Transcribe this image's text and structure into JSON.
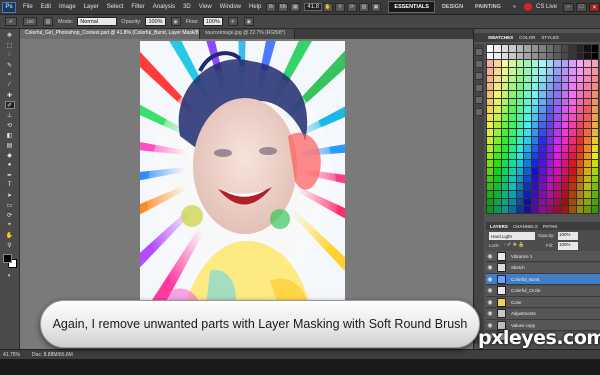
{
  "menubar": {
    "app_badge": "Ps",
    "items": [
      "File",
      "Edit",
      "Image",
      "Layer",
      "Select",
      "Filter",
      "Analysis",
      "3D",
      "View",
      "Window",
      "Help"
    ],
    "zoom_value": "41.8",
    "workspace": {
      "active": "ESSENTIALS",
      "others": [
        "DESIGN",
        "PAINTING"
      ]
    },
    "more_label": "»",
    "cslive_label": "CS Live",
    "window_controls": [
      "–",
      "□",
      "✕"
    ]
  },
  "options_bar": {
    "mode_label": "Mode:",
    "mode_value": "Normal",
    "opacity_label": "Opacity:",
    "opacity_value": "100%",
    "flow_label": "Flow:",
    "flow_value": "100%",
    "brush_size": "100"
  },
  "tabs": [
    {
      "label": "Colorful_Girl_Photoshop_Contest.psd @ 41.8% (Colorful_Burst, Layer Mask/8)",
      "active": true
    },
    {
      "label": "sourceimage.jpg @ 22.7% (RGB/8*)",
      "active": false
    }
  ],
  "toolbar": {
    "tools": [
      {
        "name": "move-tool",
        "icon": "✥"
      },
      {
        "name": "marquee-tool",
        "icon": "⬚"
      },
      {
        "name": "lasso-tool",
        "icon": "◌"
      },
      {
        "name": "quick-select-tool",
        "icon": "✎"
      },
      {
        "name": "crop-tool",
        "icon": "⌗"
      },
      {
        "name": "eyedropper-tool",
        "icon": "⁄"
      },
      {
        "name": "heal-tool",
        "icon": "✚"
      },
      {
        "name": "brush-tool",
        "icon": "✐",
        "selected": true
      },
      {
        "name": "stamp-tool",
        "icon": "⊥"
      },
      {
        "name": "history-brush-tool",
        "icon": "⟲"
      },
      {
        "name": "eraser-tool",
        "icon": "◧"
      },
      {
        "name": "gradient-tool",
        "icon": "▤"
      },
      {
        "name": "blur-tool",
        "icon": "◆"
      },
      {
        "name": "dodge-tool",
        "icon": "●"
      },
      {
        "name": "pen-tool",
        "icon": "✒"
      },
      {
        "name": "type-tool",
        "icon": "T"
      },
      {
        "name": "path-select-tool",
        "icon": "➤"
      },
      {
        "name": "shape-tool",
        "icon": "▭"
      },
      {
        "name": "3d-rotate-tool",
        "icon": "⟳"
      },
      {
        "name": "3d-camera-tool",
        "icon": "⌖"
      },
      {
        "name": "hand-tool",
        "icon": "✋"
      },
      {
        "name": "zoom-tool",
        "icon": "⚲"
      }
    ],
    "fg_color": "#000000",
    "bg_color": "#ffffff"
  },
  "status": {
    "zoom": "41.75%",
    "doc": "Doc: 8.88M/86.8M"
  },
  "swatches_panel": {
    "tabs": [
      {
        "label": "SWATCHES",
        "active": true
      },
      {
        "label": "COLOR",
        "active": false
      },
      {
        "label": "STYLES",
        "active": false
      }
    ]
  },
  "layers_panel": {
    "tabs": [
      {
        "label": "LAYERS",
        "active": true
      },
      {
        "label": "CHANNELS",
        "active": false
      },
      {
        "label": "PATHS",
        "active": false
      }
    ],
    "blend_mode": "Hard Light",
    "opacity_label": "Opacity:",
    "opacity_value": "100%",
    "lock_label": "Lock:",
    "fill_label": "Fill:",
    "fill_value": "100%",
    "layers": [
      {
        "name": "Vibrance 1",
        "selected": false,
        "thumb": "#e8e8e8"
      },
      {
        "name": "Sketch",
        "selected": false,
        "thumb": "#dcdcdc"
      },
      {
        "name": "Colorful_Burst",
        "selected": true,
        "thumb": "#6fa0ff"
      },
      {
        "name": "Colorful_Circle",
        "selected": false,
        "thumb": "#e8e8e8"
      },
      {
        "name": "Color",
        "selected": false,
        "thumb": "#f3d05a"
      },
      {
        "name": "Adjustments",
        "selected": false,
        "thumb": "#c9c9c9"
      },
      {
        "name": "Values copy",
        "selected": false,
        "thumb": "#bdbdbd"
      },
      {
        "name": "Values",
        "selected": false,
        "thumb": "#aaaaaa"
      }
    ]
  },
  "caption": "Again, I remove unwanted parts with Layer Masking with Soft Round Brush",
  "watermark": "pxleyes.com",
  "colors": {
    "accent": "#3e7fc7",
    "panel_bg": "#535353",
    "canvas_bg": "#7a7a7a"
  }
}
